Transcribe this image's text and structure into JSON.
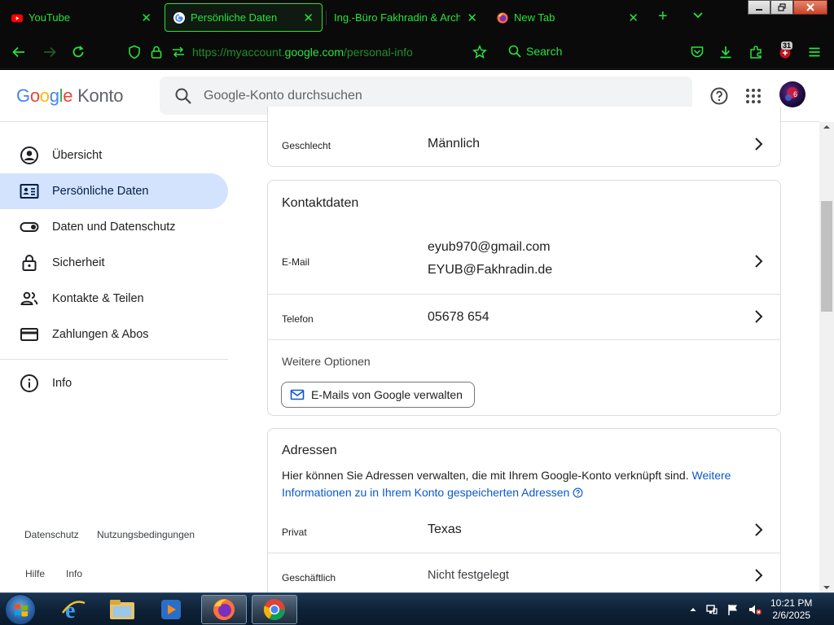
{
  "browser": {
    "tabs": [
      {
        "label": "YouTube",
        "icon": "youtube-icon"
      },
      {
        "label": "Persönliche Daten",
        "icon": "google-icon",
        "active": true
      },
      {
        "label": "Ing.-Büro Fakhradin & Arch.-B",
        "icon": "none"
      },
      {
        "label": "New Tab",
        "icon": "firefox-icon"
      }
    ],
    "url_prefix": "https://myaccount.",
    "url_host": "google.com",
    "url_path": "/personal-info",
    "search_label": "Search",
    "extension_badge": "31",
    "accent_color": "#27e33a"
  },
  "header": {
    "logo_letters": [
      "G",
      "o",
      "o",
      "g",
      "l",
      "e"
    ],
    "logo_suffix": "Konto",
    "search_placeholder": "Google-Konto durchsuchen",
    "avatar_text": "6"
  },
  "sidebar": {
    "items": [
      {
        "label": "Übersicht",
        "icon": "account-circle-icon"
      },
      {
        "label": "Persönliche Daten",
        "icon": "id-card-icon",
        "active": true
      },
      {
        "label": "Daten und Datenschutz",
        "icon": "toggle-icon"
      },
      {
        "label": "Sicherheit",
        "icon": "lock-icon"
      },
      {
        "label": "Kontakte & Teilen",
        "icon": "people-icon"
      },
      {
        "label": "Zahlungen & Abos",
        "icon": "credit-card-icon"
      }
    ],
    "info_label": "Info",
    "footer": {
      "privacy": "Datenschutz",
      "terms": "Nutzungsbedingungen",
      "help": "Hilfe",
      "info": "Info"
    }
  },
  "cards": {
    "basic": {
      "gender_label": "Geschlecht",
      "gender_value": "Männlich"
    },
    "contact": {
      "title": "Kontaktdaten",
      "email_label": "E-Mail",
      "email_values": [
        "eyub970@gmail.com",
        "EYUB@Fakhradin.de"
      ],
      "phone_label": "Telefon",
      "phone_value": "05678 654",
      "more_options": "Weitere Optionen",
      "manage_button": "E-Mails von Google verwalten"
    },
    "addresses": {
      "title": "Adressen",
      "description": "Hier können Sie Adressen verwalten, die mit Ihrem Google-Konto verknüpft sind.",
      "link": "Weitere Informationen zu in Ihrem Konto gespeicherten Adressen",
      "home_label": "Privat",
      "home_value": "Texas",
      "work_label": "Geschäftlich",
      "work_value": "Nicht festgelegt"
    }
  },
  "taskbar": {
    "time": "10:21 PM",
    "date": "2/6/2025",
    "apps": [
      "internet-explorer-icon",
      "file-explorer-icon",
      "media-player-icon",
      "firefox-icon",
      "chrome-icon"
    ]
  }
}
